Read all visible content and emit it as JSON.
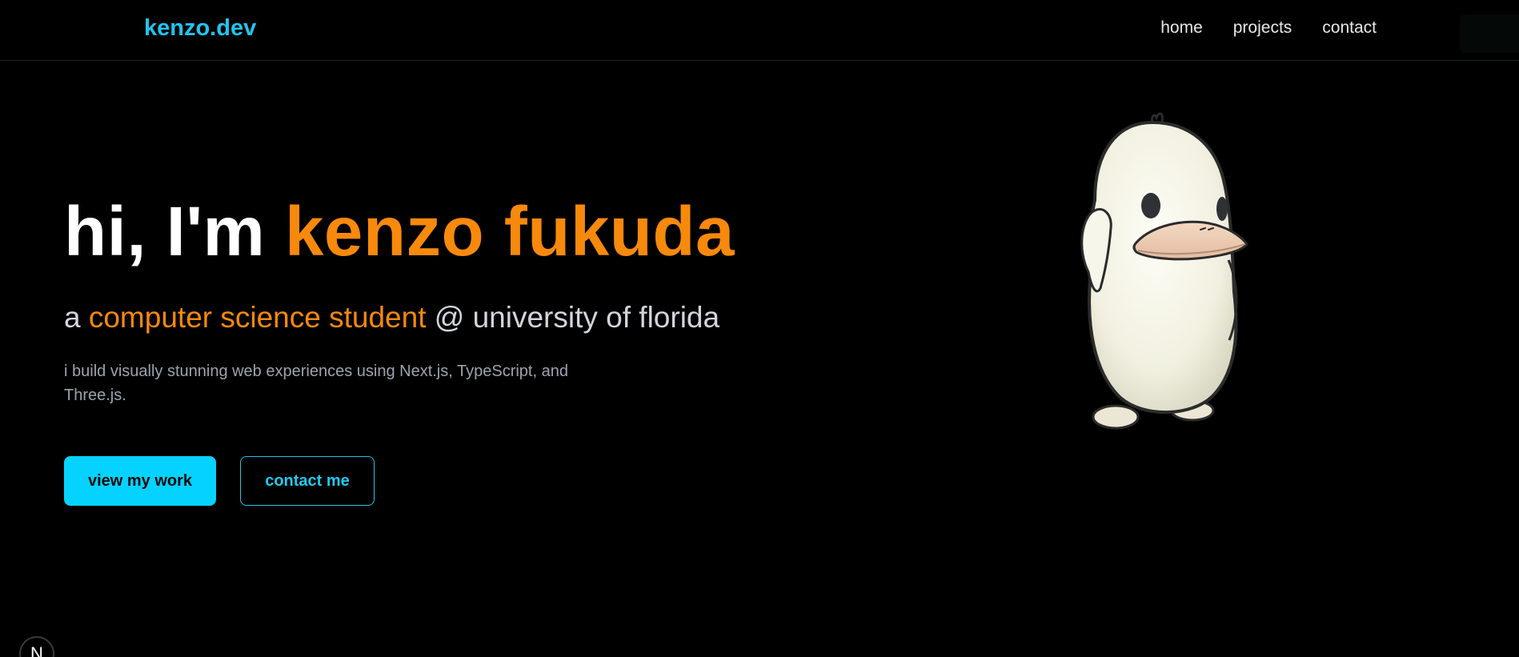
{
  "header": {
    "logo": "kenzo.dev",
    "nav": [
      {
        "label": "home"
      },
      {
        "label": "projects"
      },
      {
        "label": "contact"
      }
    ]
  },
  "hero": {
    "greeting": "hi, I'm ",
    "name": "kenzo fukuda",
    "subtitle_prefix": "a ",
    "subtitle_highlight": "computer science student",
    "subtitle_suffix": " @ university of florida",
    "description": "i build visually stunning web experiences using Next.js, TypeScript, and Three.js.",
    "primary_button": "view my work",
    "secondary_button": "contact me"
  },
  "badges": {
    "framework": "N"
  },
  "mascot": {
    "icon": "duck-mascot-3d"
  },
  "colors": {
    "background": "#000000",
    "accent_cyan": "#06d2ff",
    "accent_orange": "#f7890c",
    "text_primary": "#ffffff",
    "text_secondary": "#d1d5db",
    "text_muted": "#9ca3af"
  }
}
